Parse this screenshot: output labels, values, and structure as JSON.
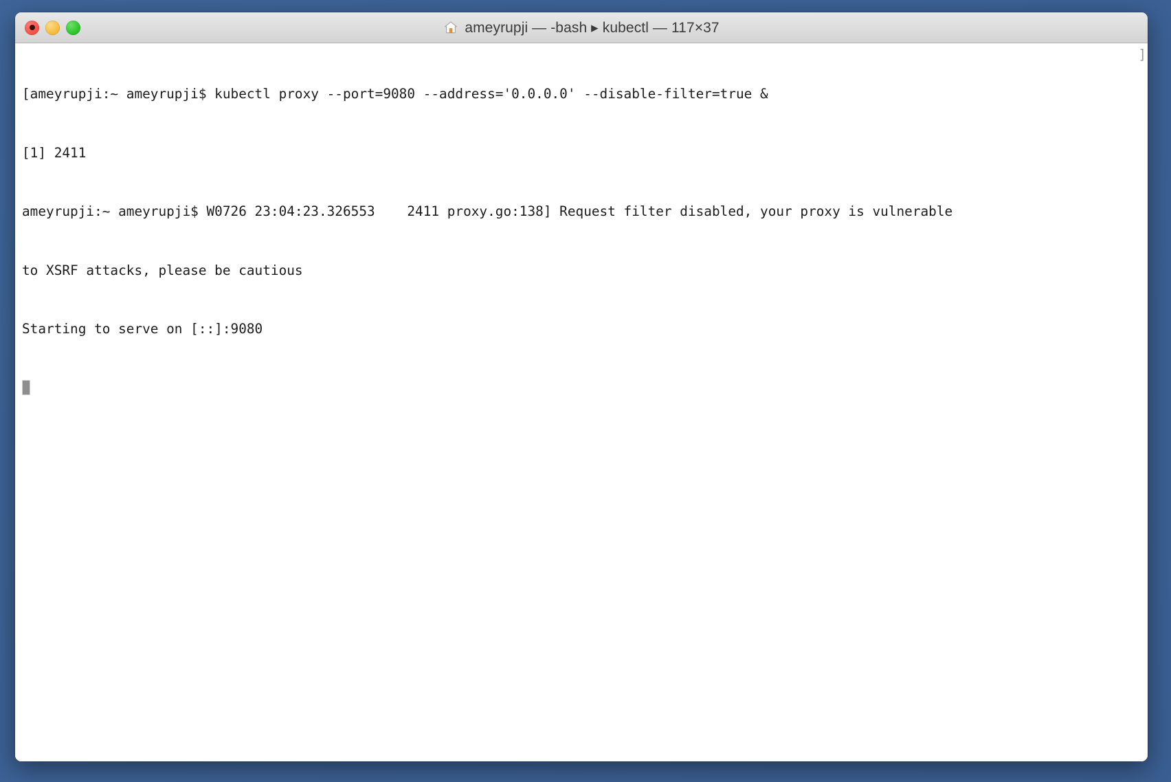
{
  "window": {
    "title": "ameyrupji — -bash ▸ kubectl — 117×37",
    "home_icon_name": "home-icon",
    "dimensions_label": "117×37",
    "controls": {
      "close_label": "Close",
      "minimize_label": "Minimize",
      "maximize_label": "Maximize"
    }
  },
  "desktop": {
    "background_color": "#3d6296"
  },
  "terminal": {
    "background_color": "#ffffff",
    "text_color": "#1c1c1c",
    "cursor_color": "#8e8e8e",
    "trailing_bracket": "]",
    "lines": [
      "[ameyrupji:~ ameyrupji$ kubectl proxy --port=9080 --address='0.0.0.0' --disable-filter=true &",
      "[1] 2411",
      "ameyrupji:~ ameyrupji$ W0726 23:04:23.326553    2411 proxy.go:138] Request filter disabled, your proxy is vulnerable",
      "to XSRF attacks, please be cautious",
      "Starting to serve on [::]:9080"
    ]
  }
}
